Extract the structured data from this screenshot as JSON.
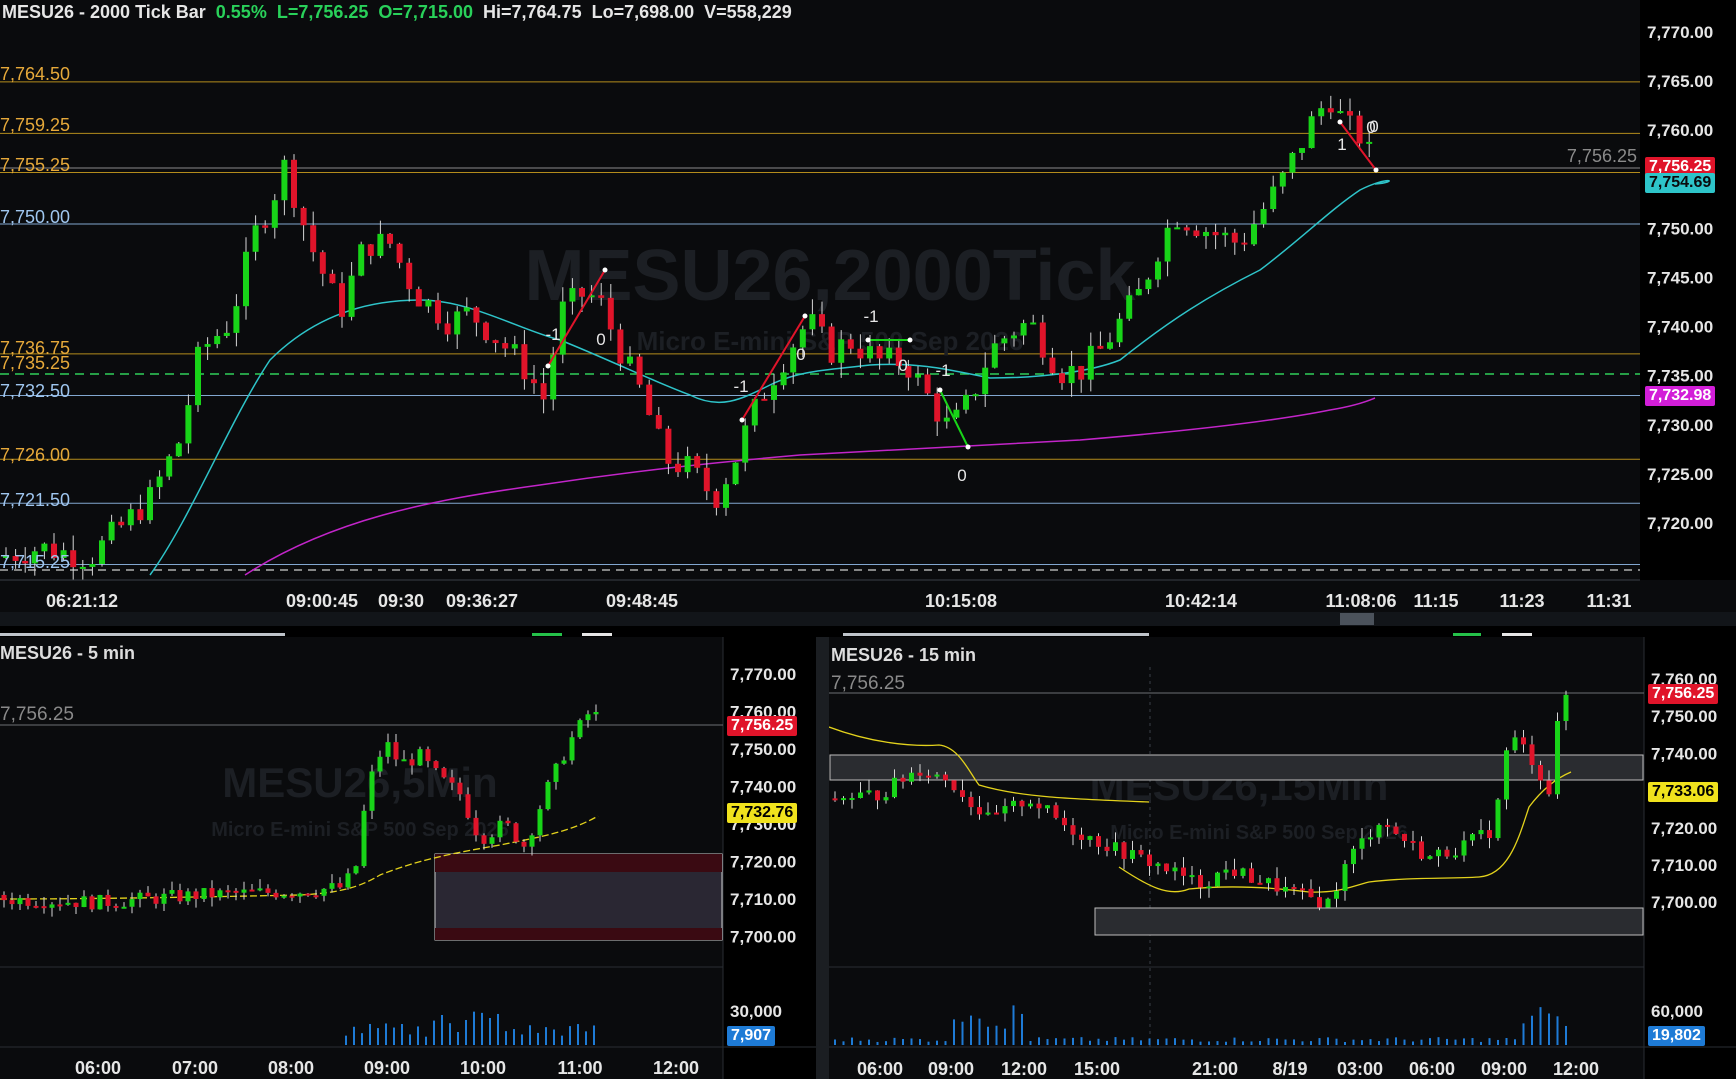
{
  "main": {
    "symbol_title": "MESU26 - 2000 Tick Bar",
    "change": "0.55%",
    "last": "L=7,756.25",
    "open": "O=7,715.00",
    "high": "Hi=7,764.75",
    "low": "Lo=7,698.00",
    "volume": "V=558,229",
    "watermark": "MESU26,2000Tick",
    "watermark_sub": "Micro E-mini S&P 500 Sep 2026",
    "price_axis": [
      "7,770.00",
      "7,765.00",
      "7,760.00",
      "7,755.00",
      "7,750.00",
      "7,745.00",
      "7,740.00",
      "7,735.00",
      "7,730.00",
      "7,725.00",
      "7,720.00"
    ],
    "level_labels": [
      "7,764.50",
      "7,759.25",
      "7,755.25",
      "7,750.00",
      "7,736.75",
      "7,735.25",
      "7,732.50",
      "7,726.00",
      "7,721.50",
      "7,715.25"
    ],
    "last_price_line_label": "7,756.25",
    "tag_last": "7,756.25",
    "tag_ma_fast": "7,754.69",
    "tag_ma_slow": "7,732.98",
    "time_axis": [
      "06:21:12",
      "09:00:45",
      "09:30",
      "09:36:27",
      "09:48:45",
      "10:15:08",
      "10:42:14",
      "11:08:06",
      "11:15",
      "11:23",
      "11:31"
    ],
    "swing_labels": [
      "-1",
      "0",
      "-1",
      "0",
      "-1",
      "0",
      "-1",
      "0",
      "0",
      "1",
      "0"
    ]
  },
  "five_min": {
    "title": "MESU26 - 5 min",
    "watermark": "MESU26,5Min",
    "watermark_sub": "Micro E-mini S&P 500 Sep 2026",
    "last_line_label": "7,756.25",
    "price_axis": [
      "7,770.00",
      "7,760.00",
      "7,750.00",
      "7,740.00",
      "7,730.00",
      "7,720.00",
      "7,710.00",
      "7,700.00"
    ],
    "tag_last": "7,756.25",
    "tag_ma": "7,732.76",
    "volume_axis": "30,000",
    "tag_volume": "7,907",
    "time_axis": [
      "06:00",
      "07:00",
      "08:00",
      "09:00",
      "10:00",
      "11:00",
      "12:00"
    ]
  },
  "fifteen_min": {
    "title": "MESU26 - 15 min",
    "watermark": "MESU26,15Min",
    "watermark_sub": "Micro E-mini S&P 500 Sep 2026",
    "last_line_label": "7,756.25",
    "price_axis": [
      "7,760.00",
      "7,750.00",
      "7,740.00",
      "7,730.00",
      "7,720.00",
      "7,710.00",
      "7,700.00"
    ],
    "tag_last": "7,756.25",
    "tag_ma": "7,733.06",
    "volume_axis": "60,000",
    "tag_volume": "19,802",
    "time_axis": [
      "06:00",
      "09:00",
      "12:00",
      "15:00",
      "21:00",
      "8/19",
      "03:00",
      "06:00",
      "09:00",
      "12:00"
    ]
  },
  "colors": {
    "up": "#18d418",
    "down": "#e0142a",
    "gold_level": "#c79a1e",
    "blue_level": "#8fb8e6",
    "ma_fast": "#2ec4c9",
    "ma_slow": "#c225c9",
    "dashed_green": "#2fd05a"
  }
}
